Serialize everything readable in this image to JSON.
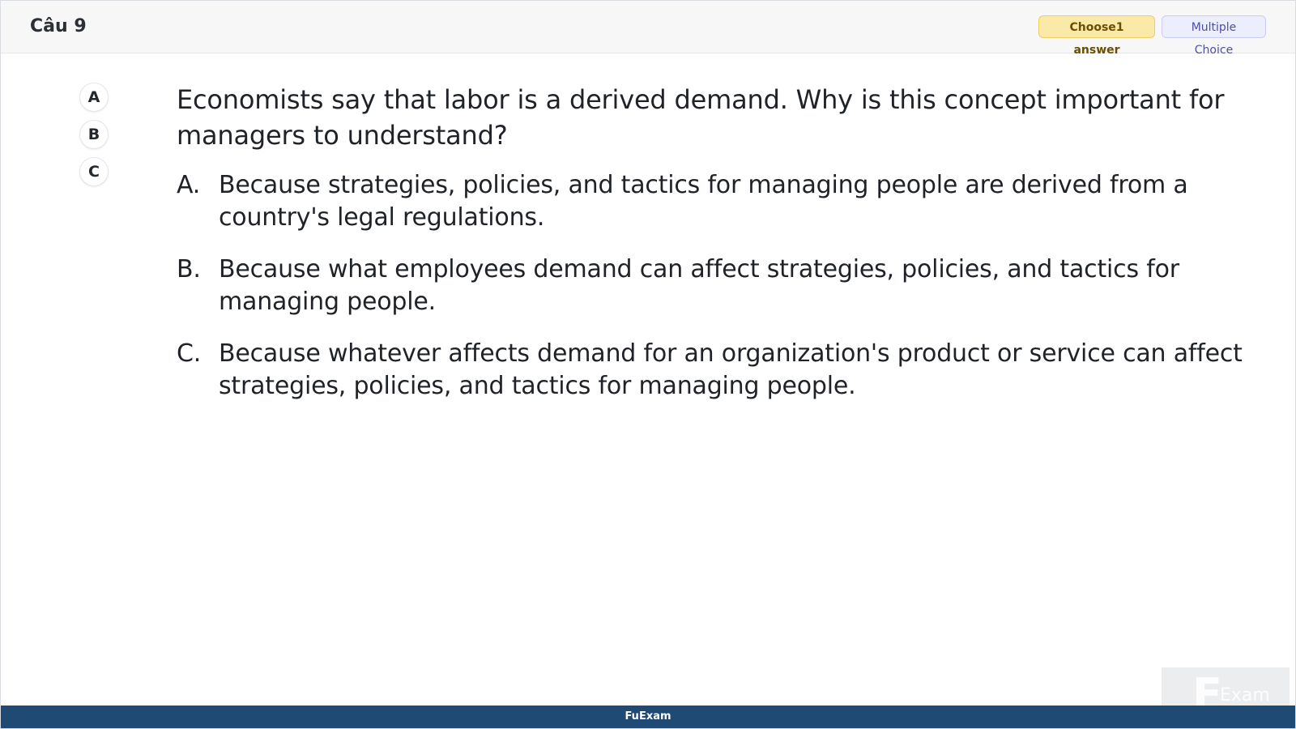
{
  "header": {
    "title": "Câu 9",
    "badge_choose": "Choose1 answer",
    "badge_type": "Multiple Choice"
  },
  "nav": {
    "items": [
      "A",
      "B",
      "C"
    ]
  },
  "question": {
    "text": "Economists say that labor is a derived demand. Why is this concept important for managers to understand?",
    "options": [
      {
        "letter": "A.",
        "text": "Because strategies, policies, and tactics for managing people are derived from a country's legal regulations."
      },
      {
        "letter": "B.",
        "text": "Because what employees demand can affect strategies, policies, and tactics for managing people."
      },
      {
        "letter": "C.",
        "text": "Because whatever affects demand for an organization's product or service can affect strategies, policies, and tactics for managing people."
      }
    ]
  },
  "footer": {
    "brand": "FuExam"
  },
  "watermark": {
    "letter": "F",
    "text": "Exam"
  }
}
